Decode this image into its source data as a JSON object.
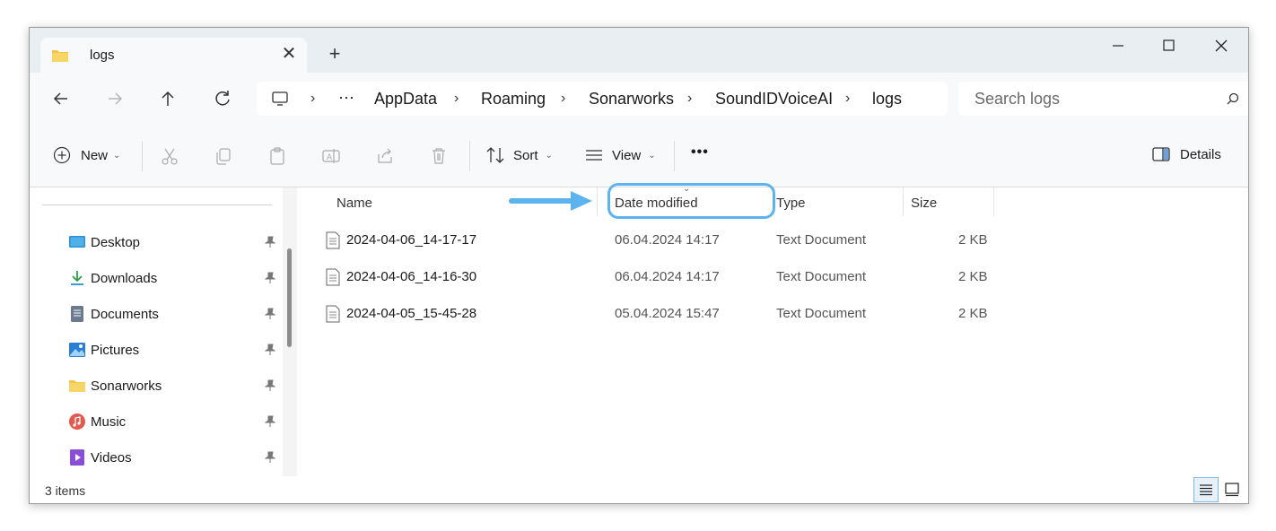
{
  "window": {
    "tab_title": "logs",
    "tab_icon": "folder-icon",
    "new_tab_symbol": "+",
    "close_tab_symbol": "✕"
  },
  "breadcrumb": {
    "overflow": "···",
    "items": [
      "AppData",
      "Roaming",
      "Sonarworks",
      "SoundIDVoiceAI",
      "logs"
    ]
  },
  "search": {
    "placeholder": "Search logs"
  },
  "toolbar": {
    "new_label": "New",
    "sort_label": "Sort",
    "view_label": "View",
    "more_label": "•••",
    "details_label": "Details"
  },
  "sidebar": {
    "items": [
      {
        "label": "Desktop",
        "icon": "desktop-icon",
        "color": "#2b8fd6"
      },
      {
        "label": "Downloads",
        "icon": "downloads-icon",
        "color": "#2ea043"
      },
      {
        "label": "Documents",
        "icon": "documents-icon",
        "color": "#6b7a8f"
      },
      {
        "label": "Pictures",
        "icon": "pictures-icon",
        "color": "#2a7fd4"
      },
      {
        "label": "Sonarworks",
        "icon": "folder-icon",
        "color": "#f4c542"
      },
      {
        "label": "Music",
        "icon": "music-icon",
        "color": "#e25a4f"
      },
      {
        "label": "Videos",
        "icon": "videos-icon",
        "color": "#8a4fd6"
      }
    ]
  },
  "columns": {
    "name": "Name",
    "date": "Date modified",
    "type": "Type",
    "size": "Size"
  },
  "files": [
    {
      "name": "2024-04-06_14-17-17",
      "date": "06.04.2024 14:17",
      "type": "Text Document",
      "size": "2 KB"
    },
    {
      "name": "2024-04-06_14-16-30",
      "date": "06.04.2024 14:17",
      "type": "Text Document",
      "size": "2 KB"
    },
    {
      "name": "2024-04-05_15-45-28",
      "date": "05.04.2024 15:47",
      "type": "Text Document",
      "size": "2 KB"
    }
  ],
  "status": {
    "item_count": "3 items"
  },
  "colors": {
    "accent": "#5db3ee",
    "titlebar": "#e9eef3"
  }
}
